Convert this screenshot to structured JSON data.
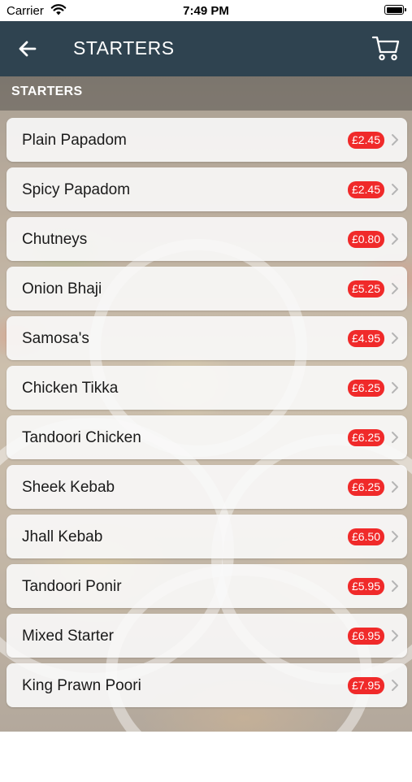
{
  "status_bar": {
    "carrier": "Carrier",
    "time": "7:49 PM",
    "icons": [
      "wifi-icon",
      "battery-icon"
    ]
  },
  "nav": {
    "title": "STARTERS",
    "back_icon": "arrow-left-icon",
    "cart_icon": "cart-icon",
    "color": "#2f4350"
  },
  "section": {
    "title": "STARTERS"
  },
  "items": [
    {
      "name": "Plain Papadom",
      "price": "£2.45"
    },
    {
      "name": "Spicy Papadom",
      "price": "£2.45"
    },
    {
      "name": "Chutneys",
      "price": "£0.80"
    },
    {
      "name": "Onion Bhaji",
      "price": "£5.25"
    },
    {
      "name": "Samosa's",
      "price": "£4.95"
    },
    {
      "name": "Chicken Tikka",
      "price": "£6.25"
    },
    {
      "name": "Tandoori Chicken",
      "price": "£6.25"
    },
    {
      "name": "Sheek Kebab",
      "price": "£6.25"
    },
    {
      "name": "Jhall Kebab",
      "price": "£6.50"
    },
    {
      "name": "Tandoori Ponir",
      "price": "£5.95"
    },
    {
      "name": "Mixed Starter",
      "price": "£6.95"
    },
    {
      "name": "King Prawn Poori",
      "price": "£7.95"
    }
  ],
  "colors": {
    "price_badge": "#f02a2a",
    "item_background": "#fafafa"
  }
}
